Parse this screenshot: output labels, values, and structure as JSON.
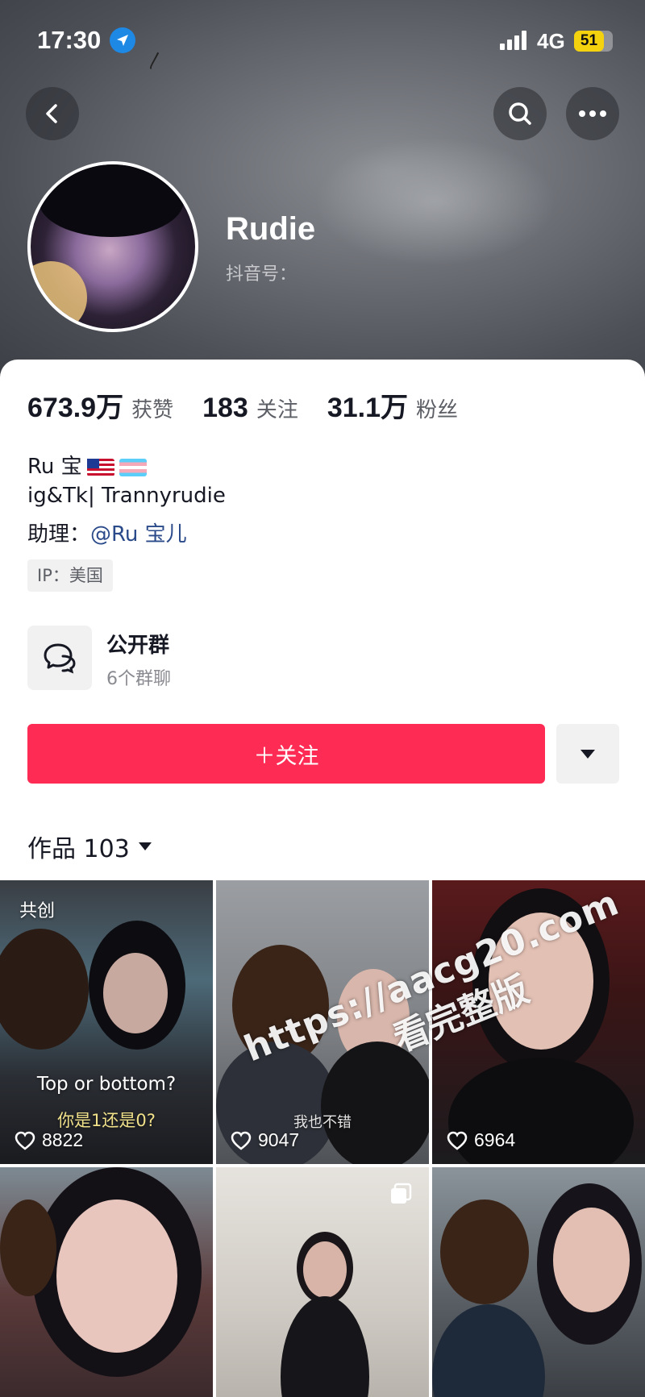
{
  "status_bar": {
    "time": "17:30",
    "network": "4G",
    "battery": "51"
  },
  "header": {
    "back_icon": "chevron-left-icon",
    "search_icon": "search-icon",
    "more_icon": "more-horizontal-icon"
  },
  "profile": {
    "name": "Rudie",
    "douyin_id_label": "抖音号："
  },
  "stats": [
    {
      "value": "673.9万",
      "label": "获赞"
    },
    {
      "value": "183",
      "label": "关注"
    },
    {
      "value": "31.1万",
      "label": "粉丝"
    }
  ],
  "bio": {
    "line1": "Ru 宝",
    "line2": "ig&Tk| Trannyrudie",
    "assistant_label": "助理：",
    "assistant_mention": "@Ru 宝儿"
  },
  "ip_tag": "IP：美国",
  "group": {
    "title": "公开群",
    "subtitle": "6个群聊"
  },
  "actions": {
    "follow_label": "＋关注"
  },
  "works": {
    "label": "作品 103"
  },
  "videos": [
    {
      "likes": "8822",
      "tag": "共创",
      "caption_1": "Top or bottom?",
      "caption_2": "你是1还是0?"
    },
    {
      "likes": "9047",
      "caption_2": "我也不错"
    },
    {
      "likes": "6964"
    },
    {},
    {},
    {}
  ],
  "watermark": {
    "url": "https://aacg20.com",
    "text": "看完整版"
  },
  "colors": {
    "accent": "#fe2c55",
    "mention": "#2a4a8a",
    "location": "#1e88e5",
    "battery": "#f4d20d"
  }
}
